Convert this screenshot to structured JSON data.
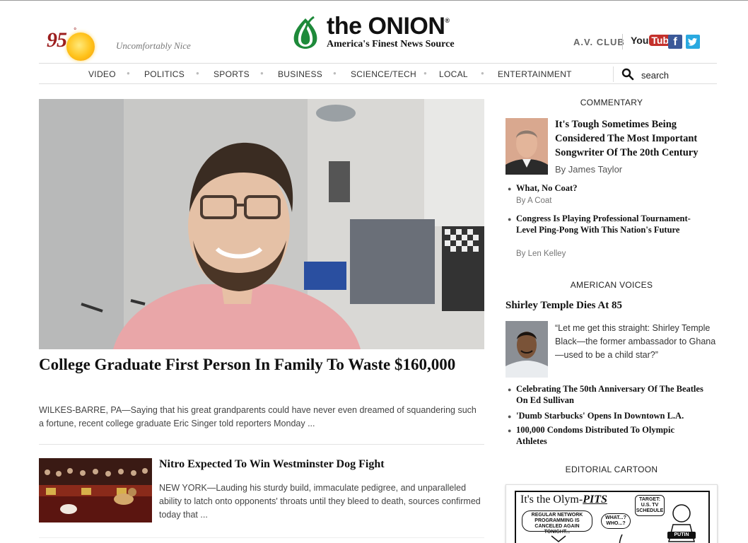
{
  "header": {
    "temperature": "95",
    "degree": "°",
    "weather_desc": "Uncomfortably Nice",
    "logo_name_a": "the",
    "logo_name_b": "ONION",
    "logo_reg": "®",
    "logo_tagline": "America's Finest News Source",
    "avclub_label": "A.V. CLUB",
    "youtube_a": "You",
    "youtube_b": "Tube",
    "facebook_glyph": "f"
  },
  "nav": {
    "items": [
      "VIDEO",
      "POLITICS",
      "SPORTS",
      "BUSINESS",
      "SCIENCE/TECH",
      "LOCAL",
      "ENTERTAINMENT"
    ],
    "search_label": "search"
  },
  "main_story": {
    "title": "College Graduate First Person In Family To Waste $160,000",
    "body": "WILKES-BARRE, PA—Saying that his great grandparents could have never even dreamed of squandering such a fortune, recent college graduate Eric Singer told reporters Monday ..."
  },
  "second_story": {
    "title": "Nitro Expected To Win Westminster Dog Fight",
    "body": "NEW YORK—Lauding his sturdy build, immaculate pedigree, and unparalleled ability to latch onto opponents' throats until they bleed to death, sources confirmed today that ..."
  },
  "sidebar": {
    "commentary_heading": "COMMENTARY",
    "commentary_title": "It's Tough Sometimes Being Considered The Most Important Songwriter Of The 20th Century",
    "commentary_byline": "By James Taylor",
    "commentary_list": [
      {
        "title": "What, No Coat?",
        "byline": "By A Coat"
      },
      {
        "title": "Congress Is Playing Professional Tournament-Level Ping-Pong With This Nation's Future",
        "byline": "By Len Kelley"
      }
    ],
    "american_voices_heading": "AMERICAN VOICES",
    "av_headline": "Shirley Temple Dies At 85",
    "av_quote": "“Let me get this straight: Shirley Temple Black—the former ambassador to Ghana—used to be a child star?”",
    "av_list": [
      "Celebrating The 50th Anniversary Of The Beatles On Ed Sullivan",
      "'Dumb Starbucks' Opens In Downtown L.A.",
      "100,000 Condoms Distributed To Olympic Athletes"
    ],
    "cartoon_heading": "EDITORIAL CARTOON",
    "cartoon_title_a": "It's the Olym-",
    "cartoon_title_b": "PITS",
    "cartoon_bubble_1": "REGULAR NETWORK PROGRAMMING IS CANCELED AGAIN TONIGHT...",
    "cartoon_bubble_2": "WHAT...? WHO...?",
    "cartoon_bubble_3": "TARGET: U.S. TV SCHEDULE",
    "cartoon_putin": "PUTIN"
  },
  "colors": {
    "temp_red": "#9c1e1e",
    "onion_green": "#1e8a3a",
    "youtube_red": "#c4302b",
    "facebook_blue": "#3b5998",
    "twitter_blue": "#2aa9e0"
  }
}
